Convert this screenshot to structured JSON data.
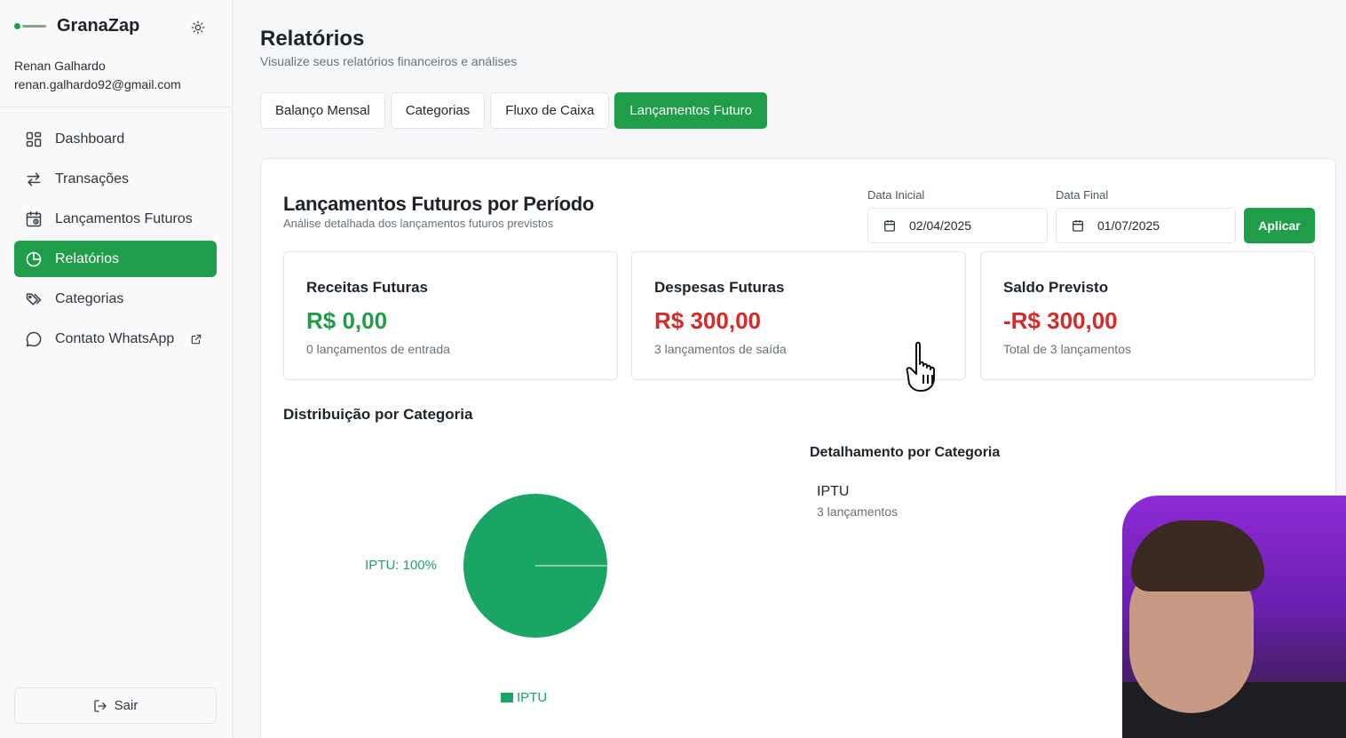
{
  "app": {
    "name": "GranaZap",
    "user_name": "Renan Galhardo",
    "user_email": "renan.galhardo92@gmail.com"
  },
  "sidebar": {
    "items": [
      {
        "label": "Dashboard",
        "icon": "grid-icon"
      },
      {
        "label": "Transações",
        "icon": "arrows-icon"
      },
      {
        "label": "Lançamentos Futuros",
        "icon": "calendar-clock-icon"
      },
      {
        "label": "Relatórios",
        "icon": "pie-icon",
        "active": true
      },
      {
        "label": "Categorias",
        "icon": "tags-icon"
      },
      {
        "label": "Contato WhatsApp",
        "icon": "chat-icon"
      }
    ],
    "logout_label": "Sair"
  },
  "page": {
    "title": "Relatórios",
    "subtitle": "Visualize seus relatórios financeiros e análises"
  },
  "tabs": [
    {
      "label": "Balanço Mensal"
    },
    {
      "label": "Categorias"
    },
    {
      "label": "Fluxo de Caixa"
    },
    {
      "label": "Lançamentos Futuro",
      "active": true
    }
  ],
  "panel": {
    "title": "Lançamentos Futuros por Período",
    "subtitle": "Análise detalhada dos lançamentos futuros previstos",
    "start_label": "Data Inicial",
    "start_value": "02/04/2025",
    "end_label": "Data Final",
    "end_value": "01/07/2025",
    "apply_label": "Aplicar"
  },
  "cards": [
    {
      "title": "Receitas Futuras",
      "value": "R$ 0,00",
      "note": "0 lançamentos de entrada",
      "color": "#1f9d48"
    },
    {
      "title": "Despesas Futuras",
      "value": "R$ 300,00",
      "note": "3 lançamentos de saída",
      "color": "#d42a2a"
    },
    {
      "title": "Saldo Previsto",
      "value": "-R$ 300,00",
      "note": "Total de 3 lançamentos",
      "color": "#d42a2a"
    }
  ],
  "distribution": {
    "title": "Distribuição por Categoria",
    "slice_label": "IPTU: 100%",
    "legend_label": "IPTU"
  },
  "chart_data": {
    "type": "pie",
    "title": "Distribuição por Categoria",
    "categories": [
      "IPTU"
    ],
    "values": [
      100
    ],
    "colors": [
      "#1aa564"
    ],
    "legend": "bottom"
  },
  "detail": {
    "title": "Detalhamento por Categoria",
    "items": [
      {
        "name": "IPTU",
        "count": "3 lançamentos"
      }
    ]
  },
  "colors": {
    "accent": "#1f9d48",
    "negative": "#d42a2a",
    "pie": "#1aa564"
  }
}
